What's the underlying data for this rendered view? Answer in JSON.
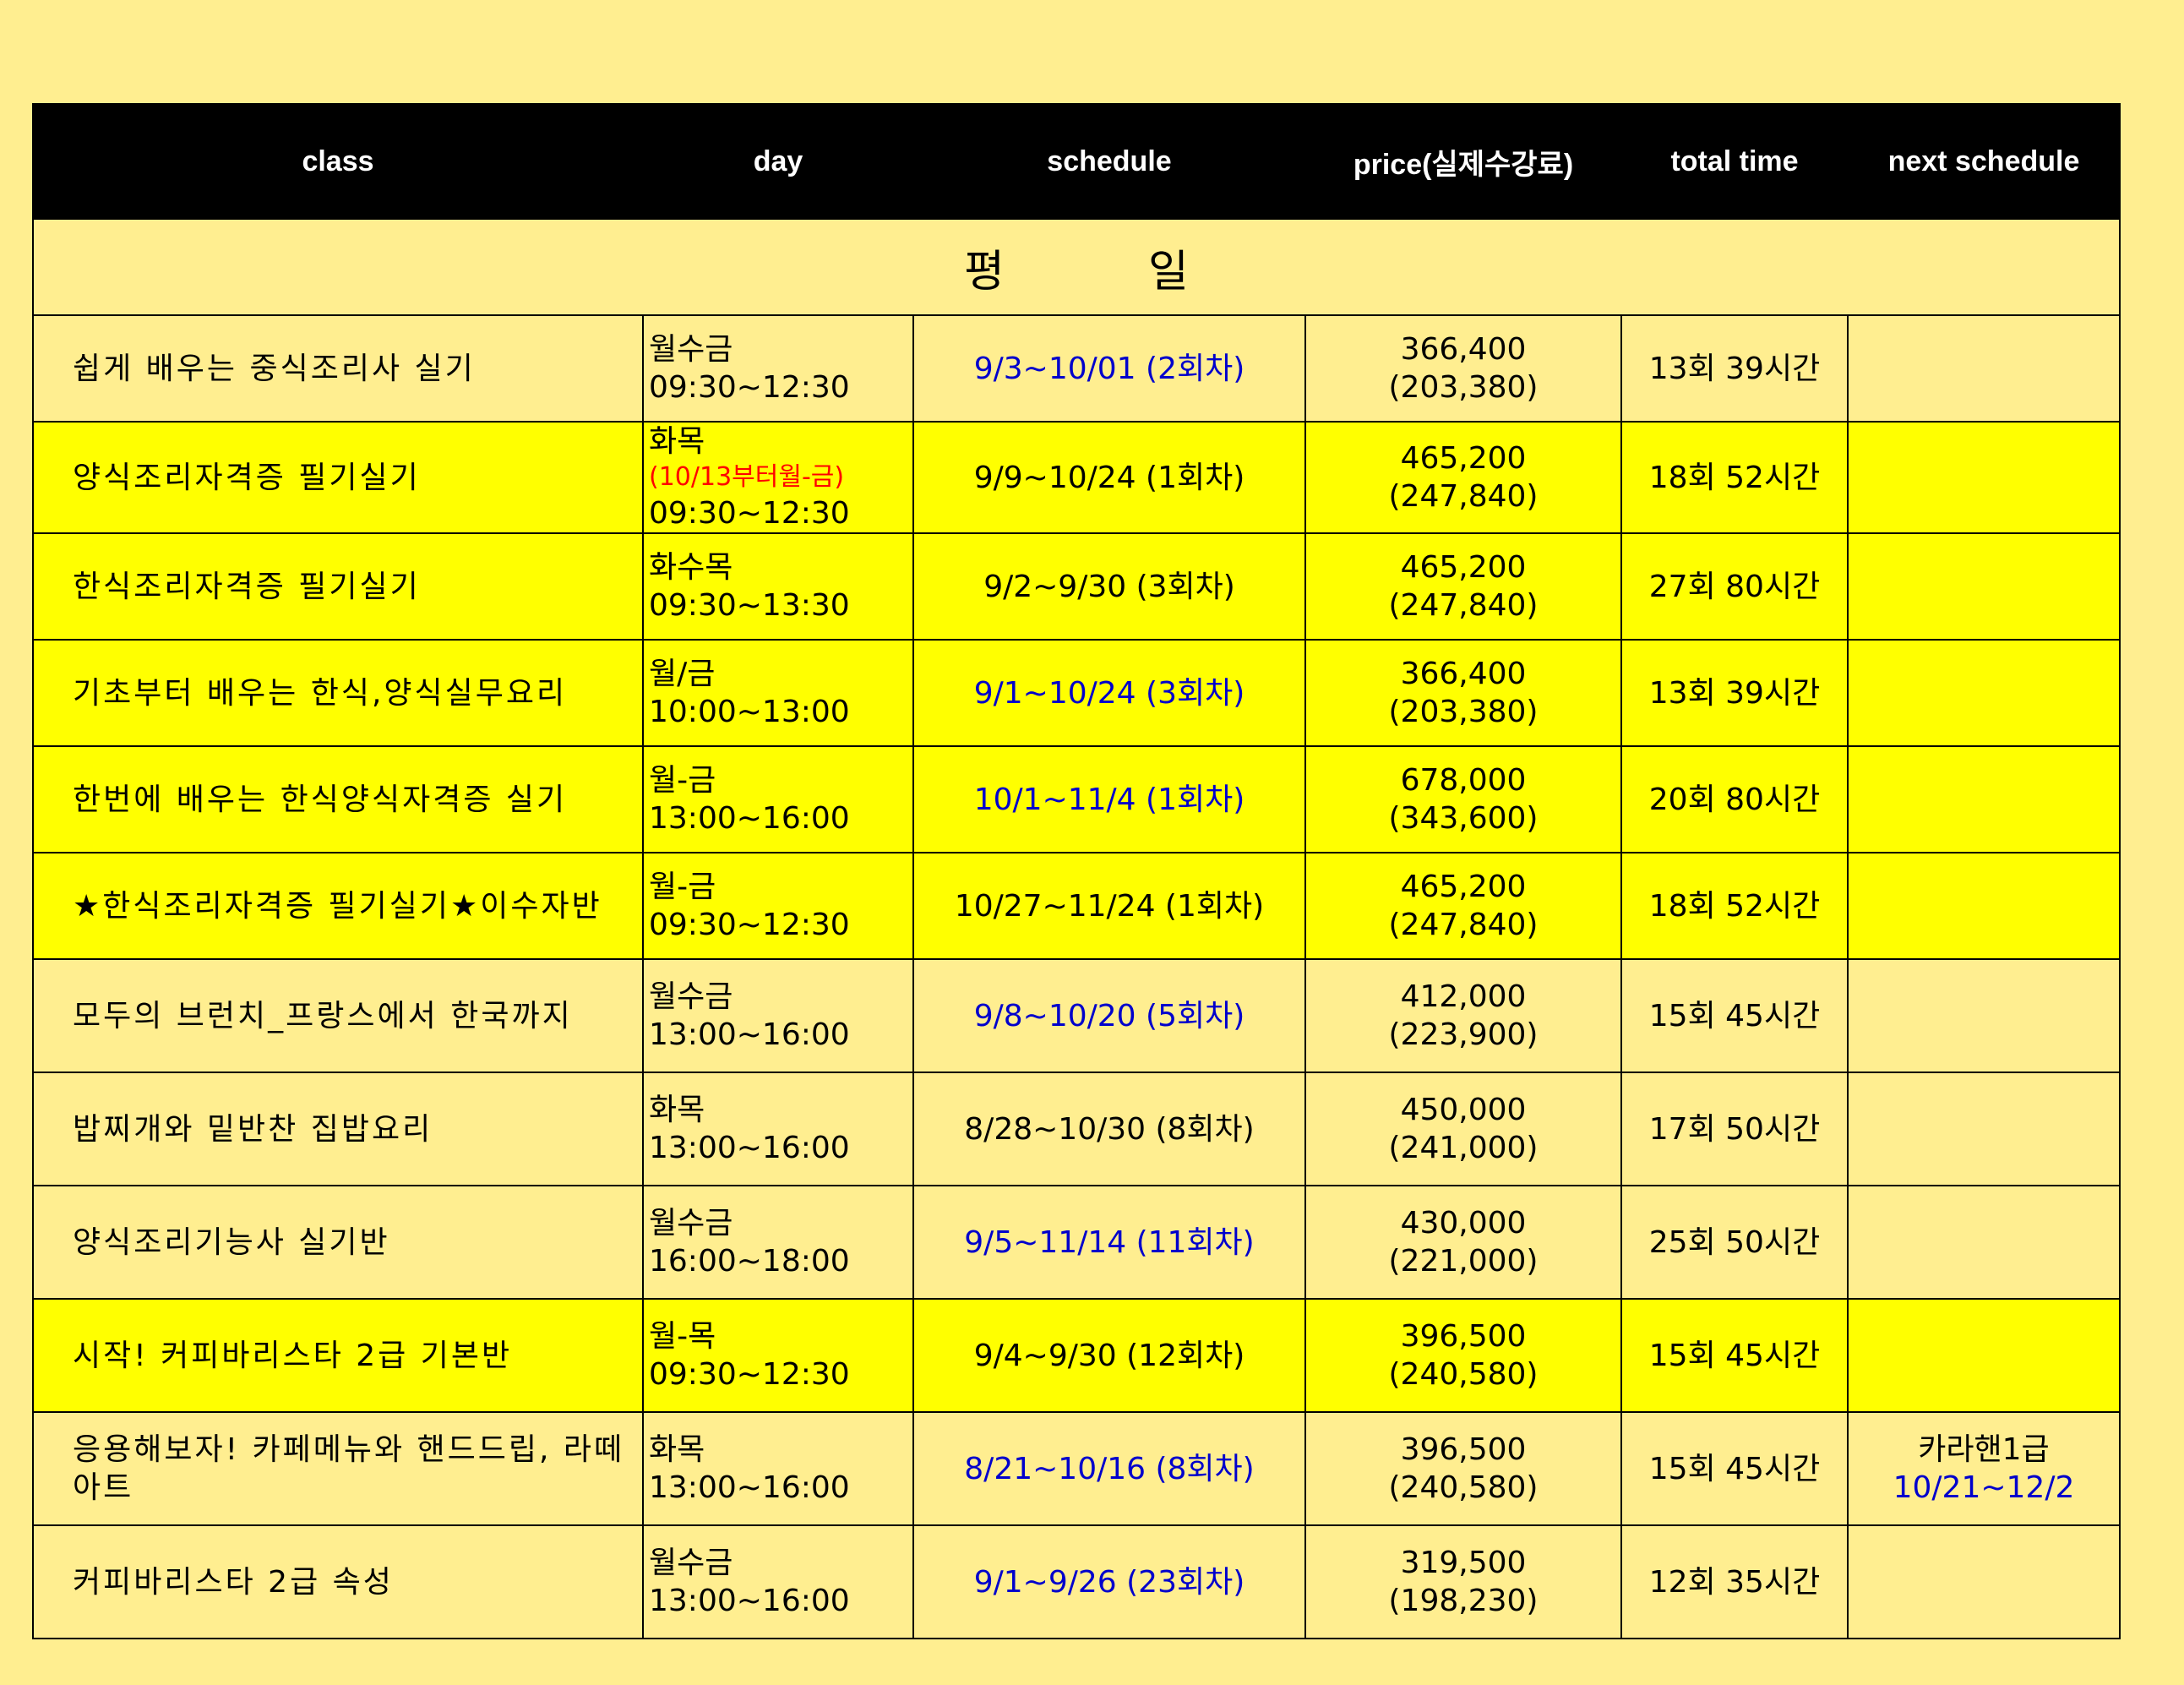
{
  "header": {
    "class": "class",
    "day": "day",
    "schedule": "schedule",
    "price": "price(실제수강료)",
    "total_time": "total time",
    "next_schedule": "next schedule"
  },
  "section": {
    "left": "평",
    "right": "일"
  },
  "colors": {
    "background": "#FFEE90",
    "highlight_row": "#FFFF00",
    "schedule_blue": "#0000CC",
    "note_red": "#FF0000",
    "header_bg": "#000000"
  },
  "rows": [
    {
      "class": "쉽게 배우는 중식조리사 실기",
      "day_line1": "월수금",
      "day_note": "",
      "day_line2": "09:30~12:30",
      "schedule": "9/3~10/01 (2회차)",
      "schedule_color": "blue",
      "price": "366,400",
      "price_actual": "(203,380)",
      "total_time": "13회 39시간",
      "next_line1": "",
      "next_line2": "",
      "bright": false
    },
    {
      "class": "양식조리자격증 필기실기",
      "day_line1": "화목",
      "day_note": "(10/13부터월-금)",
      "day_line2": "09:30~12:30",
      "schedule": "9/9~10/24 (1회차)",
      "schedule_color": "black",
      "price": "465,200",
      "price_actual": "(247,840)",
      "total_time": "18회 52시간",
      "next_line1": "",
      "next_line2": "",
      "bright": true
    },
    {
      "class": "한식조리자격증 필기실기",
      "day_line1": "화수목",
      "day_note": "",
      "day_line2": "09:30~13:30",
      "schedule": "9/2~9/30 (3회차)",
      "schedule_color": "black",
      "price": "465,200",
      "price_actual": "(247,840)",
      "total_time": "27회 80시간",
      "next_line1": "",
      "next_line2": "",
      "bright": true
    },
    {
      "class": "기초부터 배우는 한식,양식실무요리",
      "day_line1": "월/금",
      "day_note": "",
      "day_line2": "10:00~13:00",
      "schedule": "9/1~10/24 (3회차)",
      "schedule_color": "blue",
      "price": "366,400",
      "price_actual": "(203,380)",
      "total_time": "13회 39시간",
      "next_line1": "",
      "next_line2": "",
      "bright": true
    },
    {
      "class": "한번에 배우는 한식양식자격증 실기",
      "day_line1": "월-금",
      "day_note": "",
      "day_line2": "13:00~16:00",
      "schedule": "10/1~11/4 (1회차)",
      "schedule_color": "blue",
      "price": "678,000",
      "price_actual": "(343,600)",
      "total_time": "20회 80시간",
      "next_line1": "",
      "next_line2": "",
      "bright": true
    },
    {
      "class": "★한식조리자격증 필기실기★이수자반",
      "day_line1": "월-금",
      "day_note": "",
      "day_line2": "09:30~12:30",
      "schedule": "10/27~11/24 (1회차)",
      "schedule_color": "black",
      "price": "465,200",
      "price_actual": "(247,840)",
      "total_time": "18회 52시간",
      "next_line1": "",
      "next_line2": "",
      "bright": true
    },
    {
      "class": "모두의 브런치_프랑스에서 한국까지",
      "day_line1": "월수금",
      "day_note": "",
      "day_line2": "13:00~16:00",
      "schedule": "9/8~10/20 (5회차)",
      "schedule_color": "blue",
      "price": "412,000",
      "price_actual": "(223,900)",
      "total_time": "15회 45시간",
      "next_line1": "",
      "next_line2": "",
      "bright": false
    },
    {
      "class": "밥찌개와 밑반찬 집밥요리",
      "day_line1": "화목",
      "day_note": "",
      "day_line2": "13:00~16:00",
      "schedule": "8/28~10/30 (8회차)",
      "schedule_color": "black",
      "price": "450,000",
      "price_actual": "(241,000)",
      "total_time": "17회 50시간",
      "next_line1": "",
      "next_line2": "",
      "bright": false
    },
    {
      "class": "양식조리기능사 실기반",
      "day_line1": "월수금",
      "day_note": "",
      "day_line2": "16:00~18:00",
      "schedule": "9/5~11/14 (11회차)",
      "schedule_color": "blue",
      "price": "430,000",
      "price_actual": "(221,000)",
      "total_time": "25회 50시간",
      "next_line1": "",
      "next_line2": "",
      "bright": false
    },
    {
      "class": "시작! 커피바리스타 2급 기본반",
      "day_line1": "월-목",
      "day_note": "",
      "day_line2": "09:30~12:30",
      "schedule": "9/4~9/30 (12회차)",
      "schedule_color": "black",
      "price": "396,500",
      "price_actual": "(240,580)",
      "total_time": "15회 45시간",
      "next_line1": "",
      "next_line2": "",
      "bright": true
    },
    {
      "class": "응용해보자! 카페메뉴와 핸드드립, 라떼아트",
      "day_line1": "화목",
      "day_note": "",
      "day_line2": "13:00~16:00",
      "schedule": "8/21~10/16 (8회차)",
      "schedule_color": "blue",
      "price": "396,500",
      "price_actual": "(240,580)",
      "total_time": "15회 45시간",
      "next_line1": "카라핸1급",
      "next_line2": "10/21~12/2",
      "bright": false
    },
    {
      "class": "커피바리스타 2급 속성",
      "day_line1": "월수금",
      "day_note": "",
      "day_line2": "13:00~16:00",
      "schedule": "9/1~9/26 (23회차)",
      "schedule_color": "blue",
      "price": "319,500",
      "price_actual": "(198,230)",
      "total_time": "12회 35시간",
      "next_line1": "",
      "next_line2": "",
      "bright": false
    }
  ]
}
